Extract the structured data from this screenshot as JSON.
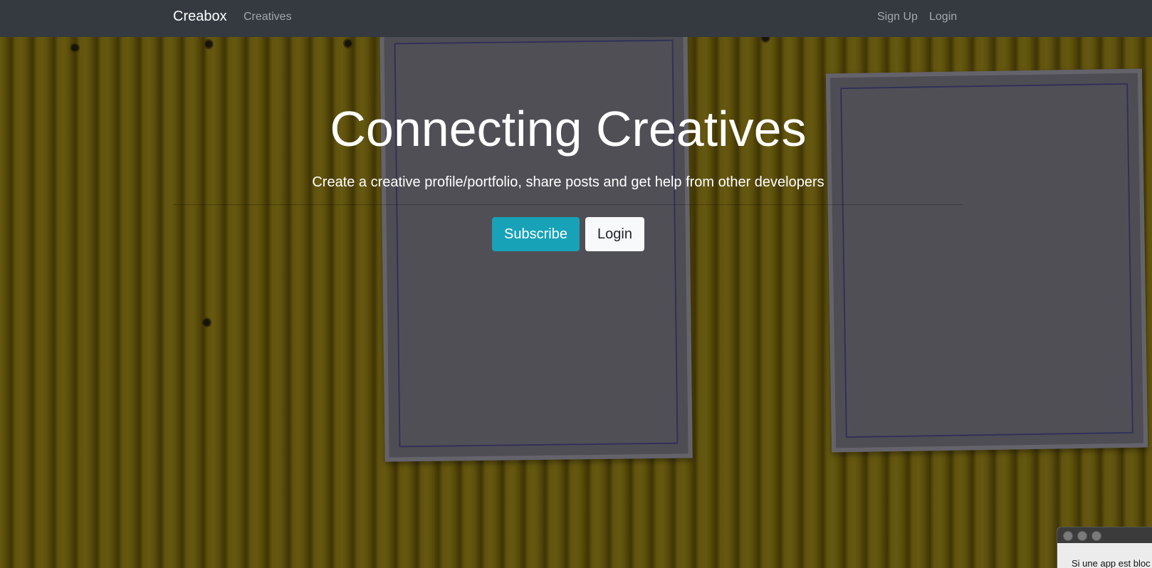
{
  "navbar": {
    "brand": "Creabox",
    "links": {
      "creatives": "Creatives",
      "sign_up": "Sign Up",
      "login": "Login"
    },
    "background": "#343a40"
  },
  "hero": {
    "title": "Connecting Creatives",
    "subtitle": "Create a creative profile/portfolio, share posts and get help from other developers",
    "buttons": {
      "subscribe": "Subscribe",
      "login": "Login"
    },
    "colors": {
      "subscribe": "#17a2b8",
      "login": "#f8f9fa"
    }
  },
  "popup": {
    "text": "Si une app est bloc"
  }
}
